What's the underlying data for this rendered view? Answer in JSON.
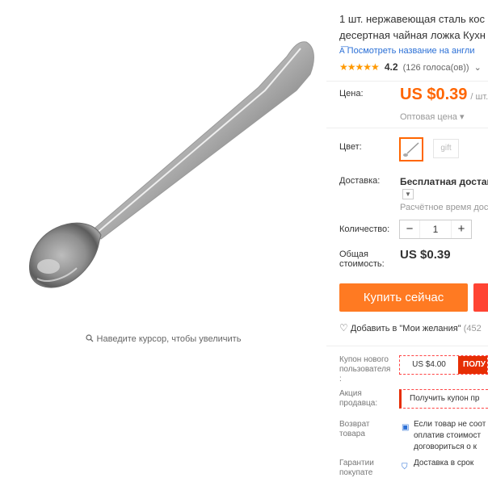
{
  "gallery": {
    "zoom_hint": "Наведите курсор, чтобы увеличить"
  },
  "product": {
    "title_line1": "1 шт. нержавеющая сталь кос",
    "title_line2": "десертная чайная ложка Кухн",
    "translate_link": "Посмотреть название на англи",
    "rating_stars": "★★★★★",
    "rating_value": "4.2",
    "votes": "(126 голоса(ов))",
    "votes_chevron": "⌄"
  },
  "price": {
    "label": "Цена:",
    "value": "US $0.39",
    "unit": "/ шт.",
    "wholesale": "Оптовая цена ▾"
  },
  "color": {
    "label": "Цвет:",
    "options": [
      "",
      "gift"
    ]
  },
  "shipping": {
    "label": "Доставка:",
    "value": "Бесплатная доставка",
    "estimate": "Расчётное время дост"
  },
  "quantity": {
    "label": "Количество:",
    "minus": "−",
    "value": "1",
    "plus": "+"
  },
  "total": {
    "label_line1": "Общая",
    "label_line2": "стоимость:",
    "value": "US $0.39"
  },
  "actions": {
    "buy_now": "Купить сейчас",
    "wishlist": "Добавить в \"Мои желания\"",
    "wishlist_count": "(452"
  },
  "coupons": {
    "new_user_label_1": "Купон нового",
    "new_user_label_2": "пользователя",
    "new_user_label_3": ":",
    "new_user_value": "US $4.00",
    "new_user_get": "ПОЛУ",
    "seller_label_1": "Акция",
    "seller_label_2": "продавца:",
    "seller_coupon": "Получить купон пр"
  },
  "returns": {
    "label_1": "Возврат",
    "label_2": "товара",
    "line1": "Если товар не соот",
    "line2": "оплатив стоимост",
    "line3": "договориться о к"
  },
  "guarantee": {
    "label_1": "Гарантии",
    "label_2": "покупате",
    "delivery": "Доставка в срок"
  },
  "colors": {
    "accent": "#ff6600",
    "buy_button": "#ff7a22",
    "link": "#2a6fd6",
    "star": "#ff9900"
  }
}
